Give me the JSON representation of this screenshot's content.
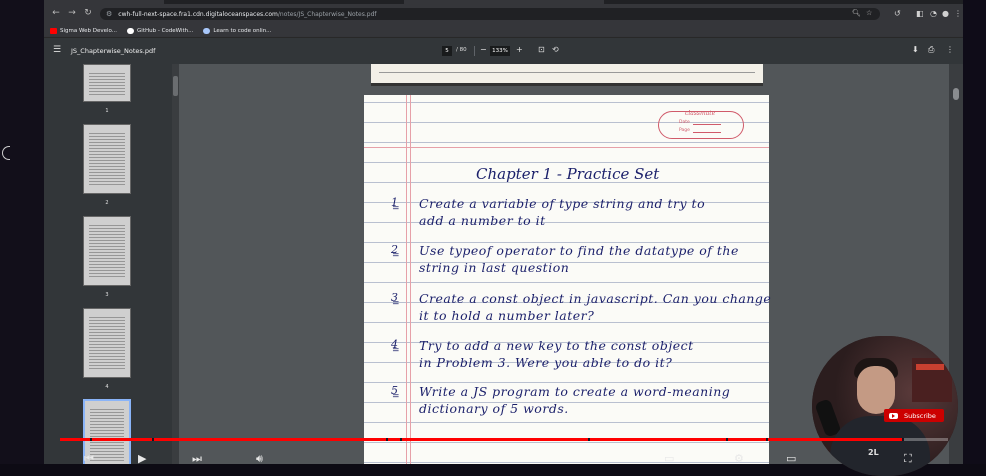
{
  "browser": {
    "url_host": "cwh-full-next-space.fra1.cdn.digitaloceanspaces.com",
    "url_path": "/notes/JS_Chapterwise_Notes.pdf",
    "bookmarks": [
      {
        "label": "Sigma Web Develo...",
        "color": "#ff0000"
      },
      {
        "label": "GitHub - CodeWith...",
        "color": "#ffffff"
      },
      {
        "label": "Learn to code onlin...",
        "color": "#a8c7fa"
      }
    ]
  },
  "pdf": {
    "filename": "JS_Chapterwise_Notes.pdf",
    "current_page": "5",
    "total_pages": "/ 80",
    "zoom": "133%",
    "thumbnails": [
      "1",
      "2",
      "3",
      "4"
    ]
  },
  "notes": {
    "brand": "classmate",
    "date_label": "Date",
    "page_label": "Page",
    "heading": "Chapter 1 - Practice Set",
    "questions": [
      {
        "num": "1",
        "line1": "Create a variable of type string and try to",
        "line2": "add a number to it"
      },
      {
        "num": "2",
        "line1": "Use typeof operator to find the datatype of the",
        "line2": "string in last question"
      },
      {
        "num": "3",
        "line1": "Create a const object in javascript. Can you change",
        "line2": "it to hold a number later?"
      },
      {
        "num": "4",
        "line1": "Try to add a new key to the const object",
        "line2": "in Problem 3. Were you able to do it?"
      },
      {
        "num": "5",
        "line1": "Write a JS program to create a word-meaning",
        "line2": "dictionary of 5 words."
      }
    ]
  },
  "overlay": {
    "subscribe_label": "Subscribe",
    "channel_logo": "2L"
  },
  "video": {
    "progress": 0.95
  },
  "colors": {
    "ink": "#1a1f6a",
    "margin": "#e6a0a8",
    "youtube_red": "#ff0000"
  }
}
